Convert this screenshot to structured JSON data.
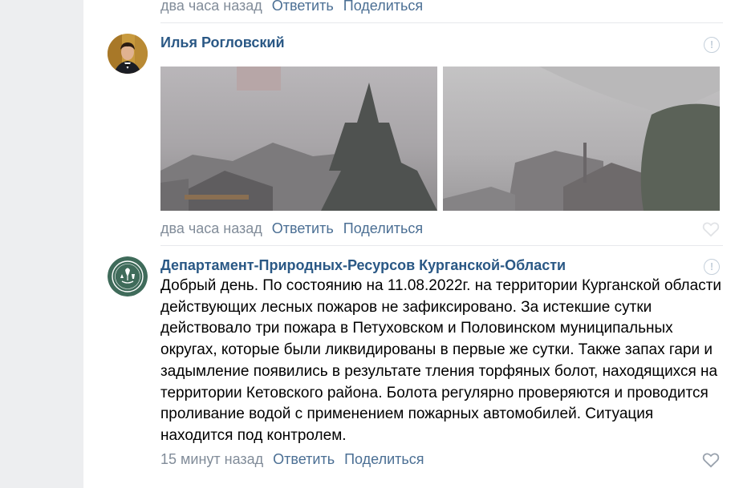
{
  "top_actions": {
    "time": "два часа назад",
    "reply": "Ответить",
    "share": "Поделиться"
  },
  "comments": [
    {
      "author": "Илья Рогловский",
      "time": "два часа назад",
      "reply": "Ответить",
      "share": "Поделиться",
      "report_icon": "exclamation-circle-icon",
      "like_icon": "heart-outline-icon"
    },
    {
      "author": "Департамент-Природных-Ресурсов Курганской-Области",
      "text": "Добрый день. По состоянию на 11.08.2022г. на территории Курганской области действующих лесных пожаров не зафиксировано. За истекшие сутки действовало три пожара в Петуховском и Половинском муниципальных округах, которые были ликвидированы в первые же сутки. Также запах гари и задымление появились в результате тления торфяных болот, находящихся на территории Кетовского района. Болота регулярно проверяются и проводится проливание водой с применением пожарных автомобилей. Ситуация находится под контролем.",
      "time": "15 минут назад",
      "reply": "Ответить",
      "share": "Поделиться",
      "report_icon": "exclamation-circle-icon",
      "like_icon": "heart-outline-icon"
    }
  ],
  "colors": {
    "link": "#4b6f94",
    "author": "#2a5885",
    "meta": "#818c99",
    "org_avatar_bg": "#3f6b5a"
  }
}
